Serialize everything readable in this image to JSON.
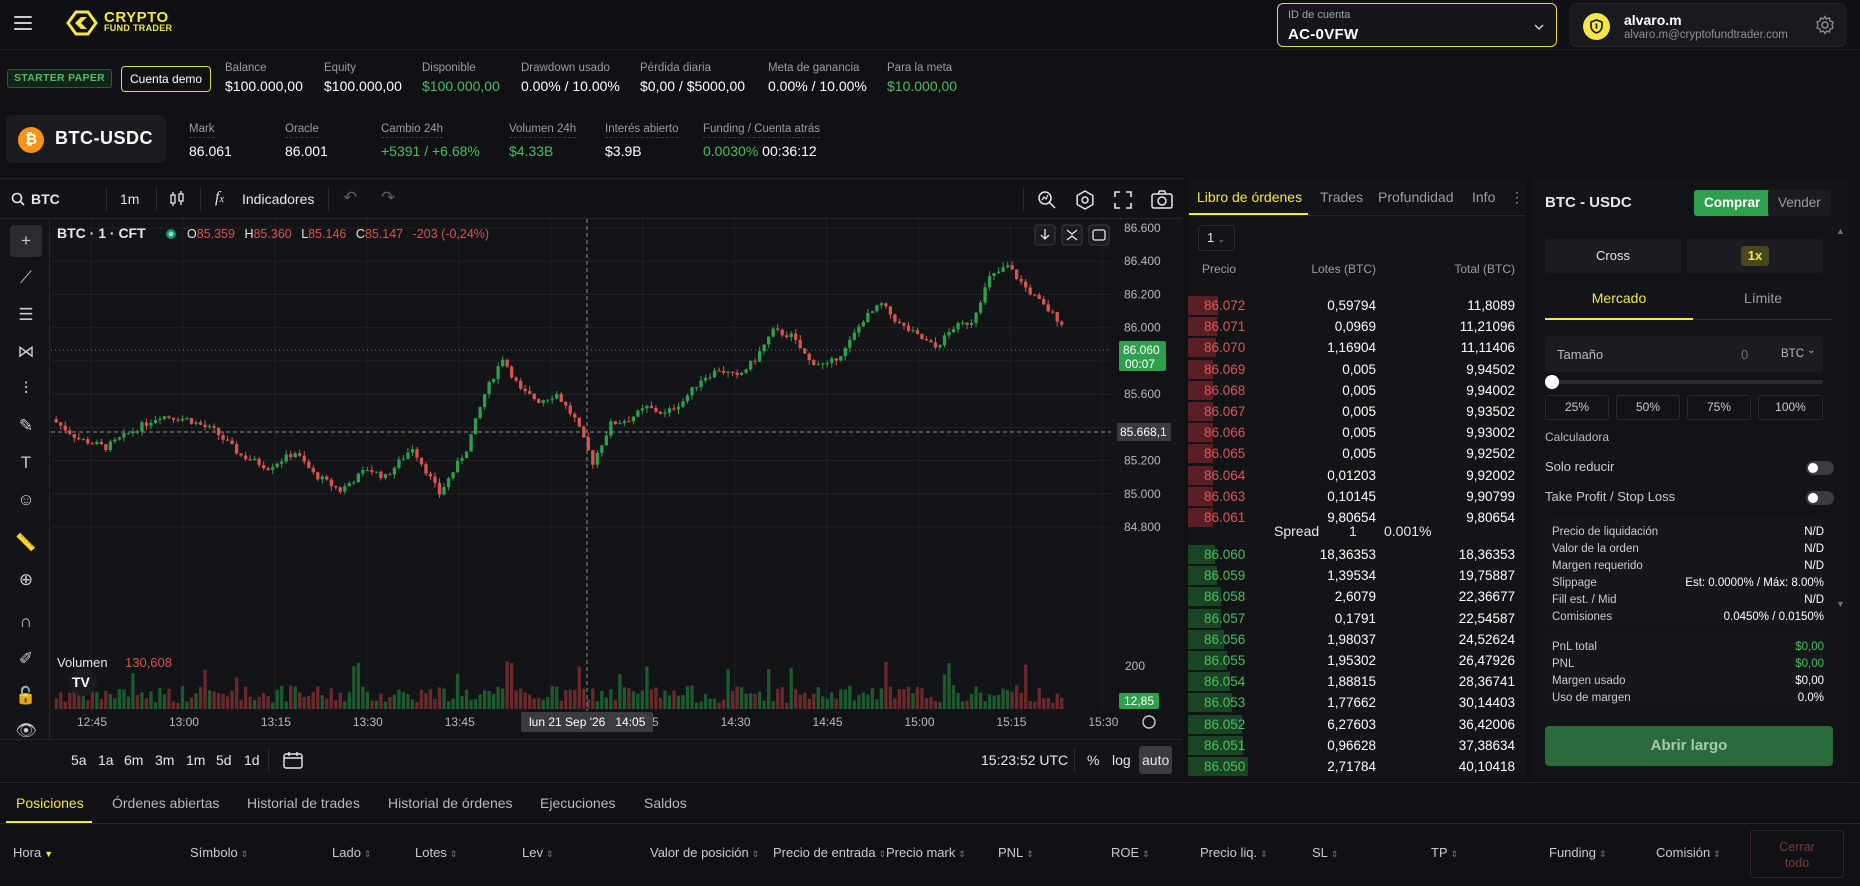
{
  "header": {
    "logo_line1": "CRYPTO",
    "logo_line2": "FUND TRADER",
    "account_label": "ID de cuenta",
    "account_id": "AC-0VFW",
    "user_name": "alvaro.m",
    "user_email": "alvaro.m@cryptofundtrader.com",
    "icons": [
      "menu-icon",
      "chevron-down-icon",
      "shield-icon",
      "gear-icon"
    ]
  },
  "stats": {
    "plan": "STARTER PAPER",
    "demo": "Cuenta demo",
    "items": [
      {
        "k": "Balance",
        "v": "$100.000,00"
      },
      {
        "k": "Equity",
        "v": "$100.000,00"
      },
      {
        "k": "Disponible",
        "v": "$100.000,00"
      },
      {
        "k": "Drawdown usado",
        "v": "0.00% / 10.00%"
      },
      {
        "k": "Pérdida diaria",
        "v": "$0,00 / $5000,00"
      },
      {
        "k": "Meta de ganancia",
        "v": "0.00% / 10.00%"
      },
      {
        "k": "Para la meta",
        "v": "$10.000,00"
      }
    ]
  },
  "market": {
    "symbol": "BTC-USDC",
    "coin_glyph": "₿",
    "items": [
      {
        "k": "Mark",
        "v": "86.061"
      },
      {
        "k": "Oracle",
        "v": "86.001"
      },
      {
        "k": "Cambio 24h",
        "v": "+5391 / +6.68%"
      },
      {
        "k": "Volumen 24h",
        "v": "$4.33B"
      },
      {
        "k": "Interés abierto",
        "v": "$3.9B"
      },
      {
        "k": "Funding / Cuenta atrás",
        "v": "0.0030%",
        "v2": "00:36:12"
      }
    ]
  },
  "chart_toolbar": {
    "search": "BTC",
    "interval": "1m",
    "indicators": "Indicadores"
  },
  "chart": {
    "legend_title": "BTC · 1 · CFT",
    "o_label": "O",
    "o": "85.359",
    "h_label": "H",
    "h": "85.360",
    "l_label": "L",
    "l": "85.146",
    "c_label": "C",
    "c": "85.147",
    "chg": "-203 (-0,24%)",
    "volume_label": "Volumen",
    "volume_value": "130,608",
    "price_tag": "86.060",
    "price_tag_time": "00:07",
    "cross_price": "85.668,1",
    "vol_tag": "12,85",
    "vol_axis": "200",
    "cross_time": "lun 21 Sep '26   14:05",
    "y_ticks": [
      "86.600",
      "86.400",
      "86.200",
      "86.000",
      "85.800",
      "85.600",
      "85.400",
      "85.200",
      "85.000",
      "84.800"
    ],
    "x_ticks": [
      "12:45",
      "13:00",
      "13:15",
      "13:30",
      "13:45",
      "14:00",
      "14:15",
      "14:30",
      "14:45",
      "15:00",
      "15:15",
      "15:30"
    ],
    "bottom_tfs": [
      "5a",
      "1a",
      "6m",
      "3m",
      "1m",
      "5d",
      "1d"
    ],
    "clock": "15:23:52 UTC",
    "pct": "%",
    "log": "log",
    "auto": "auto",
    "colors": {
      "up": "#2e9f4c",
      "down": "#d9534f"
    }
  },
  "chart_data": {
    "type": "candlestick",
    "ylim": [
      84700,
      86650
    ],
    "x_start": "12:39",
    "x_end": "15:20",
    "first_open": 85450,
    "last_close": 86030
  },
  "book": {
    "tabs": [
      "Libro de órdenes",
      "Trades",
      "Profundidad",
      "Info"
    ],
    "depth": "1",
    "h_price": "Precio",
    "h_lots": "Lotes (BTC)",
    "h_total": "Total (BTC)",
    "asks": [
      {
        "p": "86.072",
        "l": "0,59794",
        "t": "11,8089",
        "w": 0.5
      },
      {
        "p": "86.071",
        "l": "0,0969",
        "t": "11,21096",
        "w": 0.48
      },
      {
        "p": "86.070",
        "l": "1,16904",
        "t": "11,11406",
        "w": 0.47
      },
      {
        "p": "86.069",
        "l": "0,005",
        "t": "9,94502",
        "w": 0.42
      },
      {
        "p": "86.068",
        "l": "0,005",
        "t": "9,94002",
        "w": 0.42
      },
      {
        "p": "86.067",
        "l": "0,005",
        "t": "9,93502",
        "w": 0.42
      },
      {
        "p": "86.066",
        "l": "0,005",
        "t": "9,93002",
        "w": 0.42
      },
      {
        "p": "86.065",
        "l": "0,005",
        "t": "9,92502",
        "w": 0.42
      },
      {
        "p": "86.064",
        "l": "0,01203",
        "t": "9,92002",
        "w": 0.42
      },
      {
        "p": "86.063",
        "l": "0,10145",
        "t": "9,90799",
        "w": 0.42
      },
      {
        "p": "86.061",
        "l": "9,80654",
        "t": "9,80654",
        "w": 0.41
      }
    ],
    "spread_label": "Spread",
    "spread_val": "1",
    "spread_pct": "0.001%",
    "bids": [
      {
        "p": "86.060",
        "l": "18,36353",
        "t": "18,36353",
        "w": 0.45
      },
      {
        "p": "86.059",
        "l": "1,39534",
        "t": "19,75887",
        "w": 0.48
      },
      {
        "p": "86.058",
        "l": "2,6079",
        "t": "22,36677",
        "w": 0.55
      },
      {
        "p": "86.057",
        "l": "0,1791",
        "t": "22,54587",
        "w": 0.55
      },
      {
        "p": "86.056",
        "l": "1,98037",
        "t": "24,52624",
        "w": 0.6
      },
      {
        "p": "86.055",
        "l": "1,95302",
        "t": "26,47926",
        "w": 0.65
      },
      {
        "p": "86.054",
        "l": "1,88815",
        "t": "28,36741",
        "w": 0.7
      },
      {
        "p": "86.053",
        "l": "1,77662",
        "t": "30,14403",
        "w": 0.74
      },
      {
        "p": "86.052",
        "l": "6,27603",
        "t": "36,42006",
        "w": 0.9
      },
      {
        "p": "86.051",
        "l": "0,96628",
        "t": "37,38634",
        "w": 0.92
      },
      {
        "p": "86.050",
        "l": "2,71784",
        "t": "40,10418",
        "w": 1.0
      }
    ]
  },
  "order": {
    "title": "BTC - USDC",
    "buy": "Comprar",
    "sell": "Vender",
    "margin": "Cross",
    "lev": "1x",
    "type_market": "Mercado",
    "type_limit": "Límite",
    "size_label": "Tamaño",
    "size_value": "0",
    "size_unit": "BTC",
    "pcts": [
      "25%",
      "50%",
      "75%",
      "100%"
    ],
    "calc": "Calculadora",
    "reduce": "Solo reducir",
    "tpsl": "Take Profit / Stop Loss",
    "info": [
      {
        "a": "Precio de liquidación",
        "b": "N/D"
      },
      {
        "a": "Valor de la orden",
        "b": "N/D"
      },
      {
        "a": "Margen requerido",
        "b": "N/D"
      },
      {
        "a": "Slippage",
        "b": "Est: 0.0000% / Máx: 8.00%"
      },
      {
        "a": "Fill est. / Mid",
        "b": "N/D"
      },
      {
        "a": "Comisiones",
        "b": "0.0450% / 0.0150%"
      }
    ],
    "pnl": [
      {
        "a": "PnL total",
        "b": "$0,00",
        "g": true
      },
      {
        "a": "PNL",
        "b": "$0,00",
        "g": true
      },
      {
        "a": "Margen usado",
        "b": "$0,00",
        "g": false
      },
      {
        "a": "Uso de margen",
        "b": "0.0%",
        "g": false
      }
    ],
    "open_long": "Abrir largo"
  },
  "bottom": {
    "tabs": [
      "Posiciones",
      "Órdenes abiertas",
      "Historial de trades",
      "Historial de órdenes",
      "Ejecuciones",
      "Saldos"
    ],
    "cols": [
      "Hora",
      "Símbolo",
      "Lado",
      "Lotes",
      "Lev",
      "Valor de posición",
      "Precio de entrada",
      "Precio mark",
      "PNL",
      "ROE",
      "Precio liq.",
      "SL",
      "TP",
      "Funding",
      "Comisión"
    ],
    "close_all_1": "Cerrar",
    "close_all_2": "todo"
  }
}
